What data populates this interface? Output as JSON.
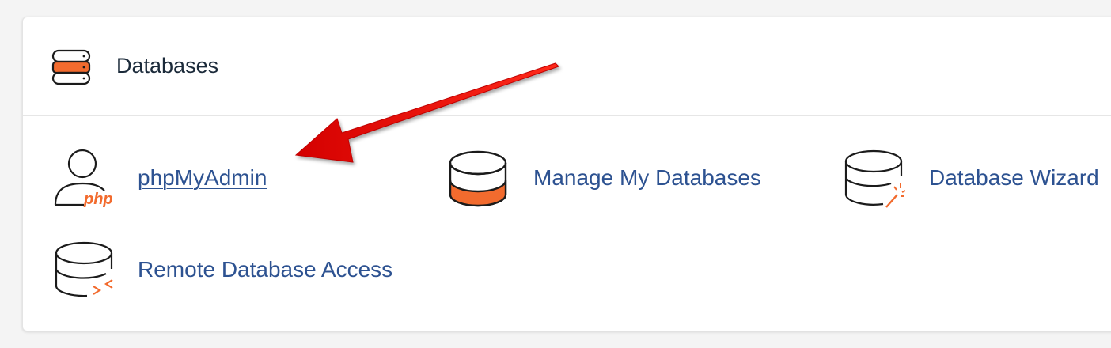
{
  "section": {
    "title": "Databases",
    "icon": "database-stack-icon"
  },
  "items": [
    {
      "label": "phpMyAdmin",
      "icon": "user-php-icon"
    },
    {
      "label": "Manage My Databases",
      "icon": "database-orange-icon"
    },
    {
      "label": "Database Wizard",
      "icon": "database-wand-icon"
    },
    {
      "label": "Remote Database Access",
      "icon": "database-remote-icon"
    }
  ],
  "icon_badges": {
    "php": "php"
  },
  "colors": {
    "accent_orange": "#f26b2e",
    "link_blue": "#2d5291",
    "heading_dark": "#1b2a3a",
    "arrow_red": "#ee1111"
  }
}
